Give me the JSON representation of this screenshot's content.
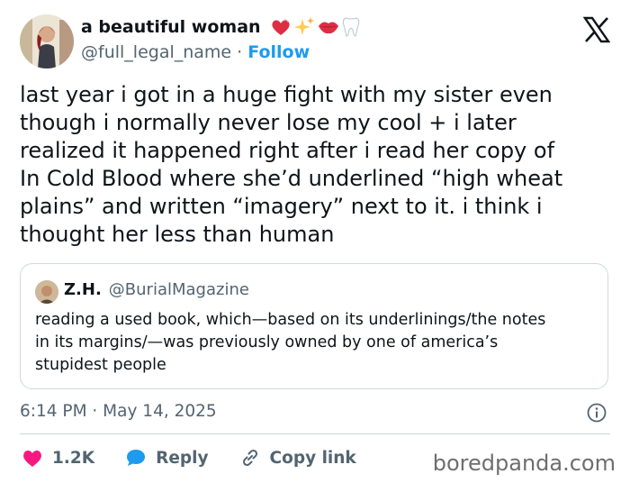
{
  "header": {
    "display_name": "a beautiful woman",
    "handle": "@full_legal_name",
    "separator": "·",
    "follow_label": "Follow",
    "emojis": [
      "heart-icon",
      "sparkles-icon",
      "lips-icon",
      "tooth-icon"
    ]
  },
  "tweet": {
    "text": "last year i got in a huge fight with my sister even\nthough i normally never lose my cool + i later\nrealized it happened right after i read her copy of\nIn Cold Blood where she’d underlined “high wheat\nplains” and written “imagery” next to it. i think i\nthought her less than human"
  },
  "quote": {
    "name": "Z.H.",
    "handle": "@BurialMagazine",
    "text": "reading a used book, which—based on its underlinings/the notes\nin its margins/—was previously owned by one of america’s\nstupidest people"
  },
  "meta": {
    "timestamp": "6:14 PM · May 14, 2025"
  },
  "actions": {
    "likes": "1.2K",
    "reply_label": "Reply",
    "copy_label": "Copy link"
  },
  "watermark": "boredpanda.com",
  "colors": {
    "accent": "#1d9bf0",
    "like": "#f91880",
    "muted": "#536471"
  }
}
